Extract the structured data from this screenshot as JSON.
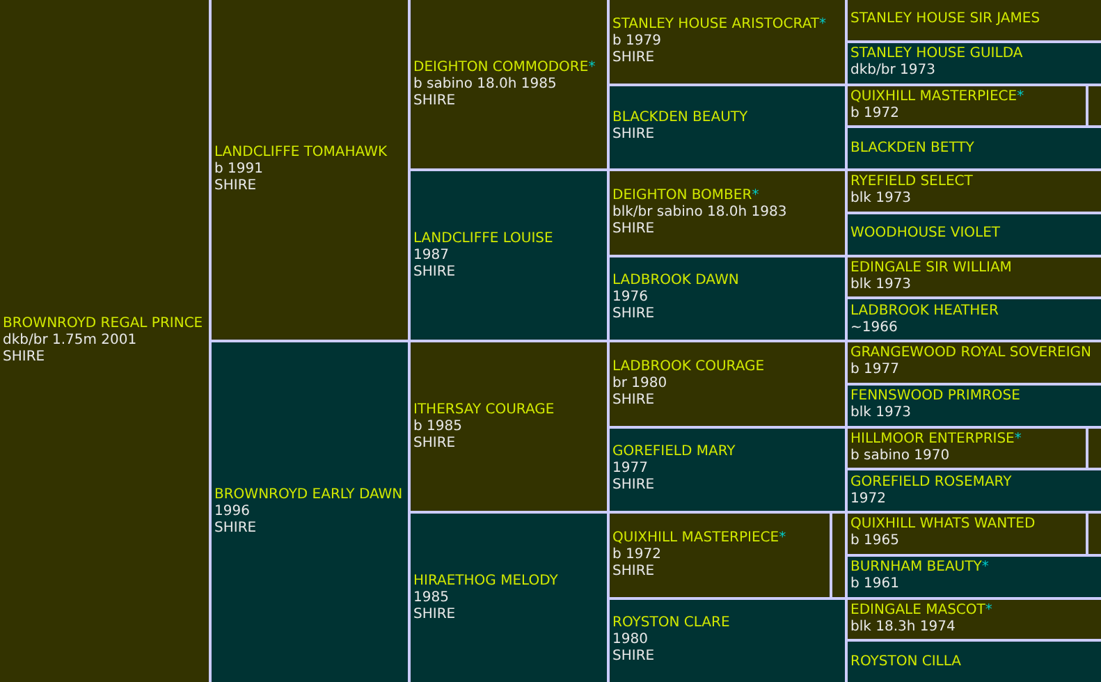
{
  "pedigree": {
    "name": "BROWNROYD REGAL PRINCE",
    "kind": "subject",
    "details": [
      "dkb/br 1.75m 2001",
      "SHIRE"
    ],
    "children": [
      {
        "name": "LANDCLIFFE TOMAHAWK",
        "kind": "sire",
        "details": [
          "b 1991",
          "SHIRE"
        ],
        "children": [
          {
            "name": "DEIGHTON COMMODORE",
            "asterisk": "*",
            "kind": "sire",
            "details": [
              "b sabino 18.0h 1985",
              "SHIRE"
            ],
            "children": [
              {
                "name": "STANLEY HOUSE ARISTOCRAT",
                "asterisk": "*",
                "kind": "sire",
                "details": [
                  "b 1979",
                  "SHIRE"
                ],
                "children": [
                  {
                    "name": "STANLEY HOUSE SIR JAMES",
                    "kind": "sire"
                  },
                  {
                    "name": "STANLEY HOUSE GUILDA",
                    "kind": "dam",
                    "details": [
                      "dkb/br 1973"
                    ]
                  }
                ]
              },
              {
                "name": "BLACKDEN BEAUTY",
                "kind": "dam",
                "details": [
                  "SHIRE"
                ],
                "children": [
                  {
                    "name": "QUIXHILL MASTERPIECE",
                    "asterisk": "*",
                    "kind": "sire",
                    "details": [
                      "b 1972"
                    ],
                    "more_ancestors": true
                  },
                  {
                    "name": "BLACKDEN BETTY",
                    "kind": "dam"
                  }
                ]
              }
            ]
          },
          {
            "name": "LANDCLIFFE LOUISE",
            "kind": "dam",
            "details": [
              "1987",
              "SHIRE"
            ],
            "children": [
              {
                "name": "DEIGHTON BOMBER",
                "asterisk": "*",
                "kind": "sire",
                "details": [
                  "blk/br sabino 18.0h 1983",
                  "SHIRE"
                ],
                "children": [
                  {
                    "name": "RYEFIELD SELECT",
                    "kind": "sire",
                    "details": [
                      "blk 1973"
                    ]
                  },
                  {
                    "name": "WOODHOUSE VIOLET",
                    "kind": "dam"
                  }
                ]
              },
              {
                "name": "LADBROOK DAWN",
                "kind": "dam",
                "details": [
                  "1976",
                  "SHIRE"
                ],
                "children": [
                  {
                    "name": "EDINGALE SIR WILLIAM",
                    "kind": "sire",
                    "details": [
                      "blk 1973"
                    ]
                  },
                  {
                    "name": "LADBROOK HEATHER",
                    "kind": "dam",
                    "details": [
                      "~1966"
                    ]
                  }
                ]
              }
            ]
          }
        ]
      },
      {
        "name": "BROWNROYD EARLY DAWN",
        "kind": "dam",
        "details": [
          "1996",
          "SHIRE"
        ],
        "children": [
          {
            "name": "ITHERSAY COURAGE",
            "kind": "sire",
            "details": [
              "b 1985",
              "SHIRE"
            ],
            "children": [
              {
                "name": "LADBROOK COURAGE",
                "kind": "sire",
                "details": [
                  "br 1980",
                  "SHIRE"
                ],
                "children": [
                  {
                    "name": "GRANGEWOOD ROYAL SOVEREIGN",
                    "kind": "sire",
                    "details": [
                      "b 1977"
                    ]
                  },
                  {
                    "name": "FENNSWOOD PRIMROSE",
                    "kind": "dam",
                    "details": [
                      "blk 1973"
                    ]
                  }
                ]
              },
              {
                "name": "GOREFIELD MARY",
                "kind": "dam",
                "details": [
                  "1977",
                  "SHIRE"
                ],
                "children": [
                  {
                    "name": "HILLMOOR ENTERPRISE",
                    "asterisk": "*",
                    "kind": "sire",
                    "details": [
                      "b sabino 1970"
                    ],
                    "more_ancestors": true
                  },
                  {
                    "name": "GOREFIELD ROSEMARY",
                    "kind": "dam",
                    "details": [
                      "1972"
                    ]
                  }
                ]
              }
            ]
          },
          {
            "name": "HIRAETHOG MELODY",
            "kind": "dam",
            "details": [
              "1985",
              "SHIRE"
            ],
            "children": [
              {
                "name": "QUIXHILL MASTERPIECE",
                "asterisk": "*",
                "kind": "sire",
                "details": [
                  "b 1972",
                  "SHIRE"
                ],
                "more_ancestors": true,
                "children": [
                  {
                    "name": "QUIXHILL WHATS WANTED",
                    "kind": "sire",
                    "details": [
                      "b 1965"
                    ],
                    "more_ancestors": true
                  },
                  {
                    "name": "BURNHAM BEAUTY",
                    "asterisk": "*",
                    "kind": "dam",
                    "details": [
                      "b 1961"
                    ]
                  }
                ]
              },
              {
                "name": "ROYSTON CLARE",
                "kind": "dam",
                "details": [
                  "1980",
                  "SHIRE"
                ],
                "children": [
                  {
                    "name": "EDINGALE MASCOT",
                    "asterisk": "*",
                    "kind": "sire",
                    "details": [
                      "blk 18.3h 1974"
                    ]
                  },
                  {
                    "name": "ROYSTON CILLA",
                    "kind": "dam"
                  }
                ]
              }
            ]
          }
        ]
      }
    ]
  }
}
